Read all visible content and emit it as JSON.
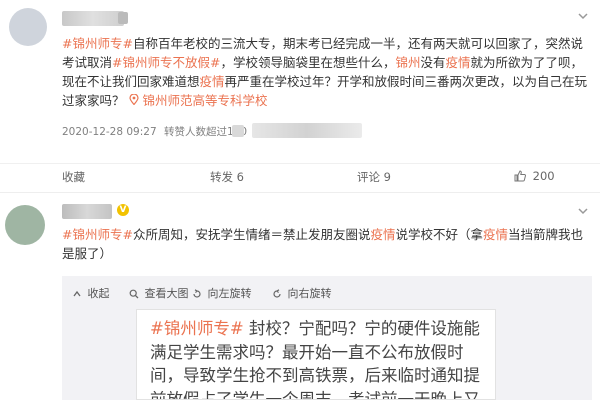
{
  "post1": {
    "text_segments": [
      {
        "t": "#锦州师专#",
        "k": "tag"
      },
      {
        "t": "自称百年老校的三流大专，期末考已经完成一半，还有两天就可以回家了，突然说考试取消",
        "k": "plain"
      },
      {
        "t": "#锦州师专不放假#",
        "k": "tag"
      },
      {
        "t": "，学校领导脑袋里在想些什么，",
        "k": "plain"
      },
      {
        "t": "锦州",
        "k": "link"
      },
      {
        "t": "没有",
        "k": "plain"
      },
      {
        "t": "疫情",
        "k": "link"
      },
      {
        "t": "就为所欲为了了呗，现在不让我们回家难道想",
        "k": "plain"
      },
      {
        "t": "疫情",
        "k": "link"
      },
      {
        "t": "再严重在学校过年？开学和放假时间三番两次更改，以为自己在玩过家家吗？",
        "k": "plain"
      }
    ],
    "location_icon": "location-pin-icon",
    "location_text": "锦州师范高等专科学校",
    "timestamp": "2020-12-28 09:27",
    "read_text": "转赞人数超过100",
    "actions": {
      "favorite_label": "收藏",
      "forward_label": "转发 6",
      "comment_label": "评论 9",
      "like_count": "200"
    }
  },
  "post2": {
    "text_segments": [
      {
        "t": "#锦州师专#",
        "k": "tag"
      },
      {
        "t": "众所周知，安抚学生情绪＝禁止发朋友圈说",
        "k": "plain"
      },
      {
        "t": "疫情",
        "k": "link"
      },
      {
        "t": "说学校不好（拿",
        "k": "plain"
      },
      {
        "t": "疫情",
        "k": "link"
      },
      {
        "t": "当挡箭牌我也是服了）",
        "k": "plain"
      }
    ],
    "media_toolbar": {
      "collapse_label": "收起",
      "view_large_label": "查看大图",
      "rotate_left_label": "向左旋转",
      "rotate_right_label": "向右旋转"
    },
    "image_text_tag": "#锦州师专#",
    "image_text_body": "  封校？宁配吗？宁的硬件设施能满足学生需求吗？最开始一直不公布放假时间，导致学生抢不到高铁票，后来临时通知提前放假占了学生一个周末，考试前一天晚上又"
  },
  "colors": {
    "accent": "#eb7350",
    "text": "#333333",
    "meta": "#808080",
    "panel": "#f2f2f5"
  }
}
